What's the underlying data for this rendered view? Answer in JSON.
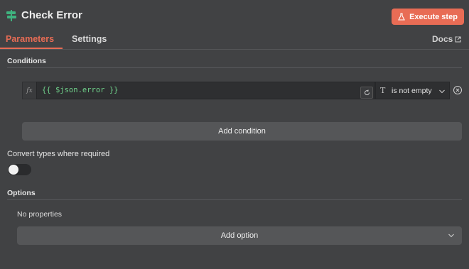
{
  "header": {
    "title": "Check Error",
    "icon": "signpost-icon",
    "execute_label": "Execute step",
    "execute_icon": "flask-icon",
    "accent_color": "#e86c55"
  },
  "tabs": {
    "items": [
      {
        "label": "Parameters",
        "active": true
      },
      {
        "label": "Settings",
        "active": false
      }
    ],
    "docs_label": "Docs",
    "docs_icon": "external-link-icon"
  },
  "conditions": {
    "section_label": "Conditions",
    "rows": [
      {
        "fx_label": "fx",
        "expression": "{{ $json.error }}",
        "operator_type_icon": "T",
        "operator": "is not empty"
      }
    ],
    "add_condition_label": "Add condition"
  },
  "convert_types": {
    "label": "Convert types where required",
    "enabled": false
  },
  "options": {
    "section_label": "Options",
    "empty_text": "No properties",
    "add_option_label": "Add option"
  }
}
